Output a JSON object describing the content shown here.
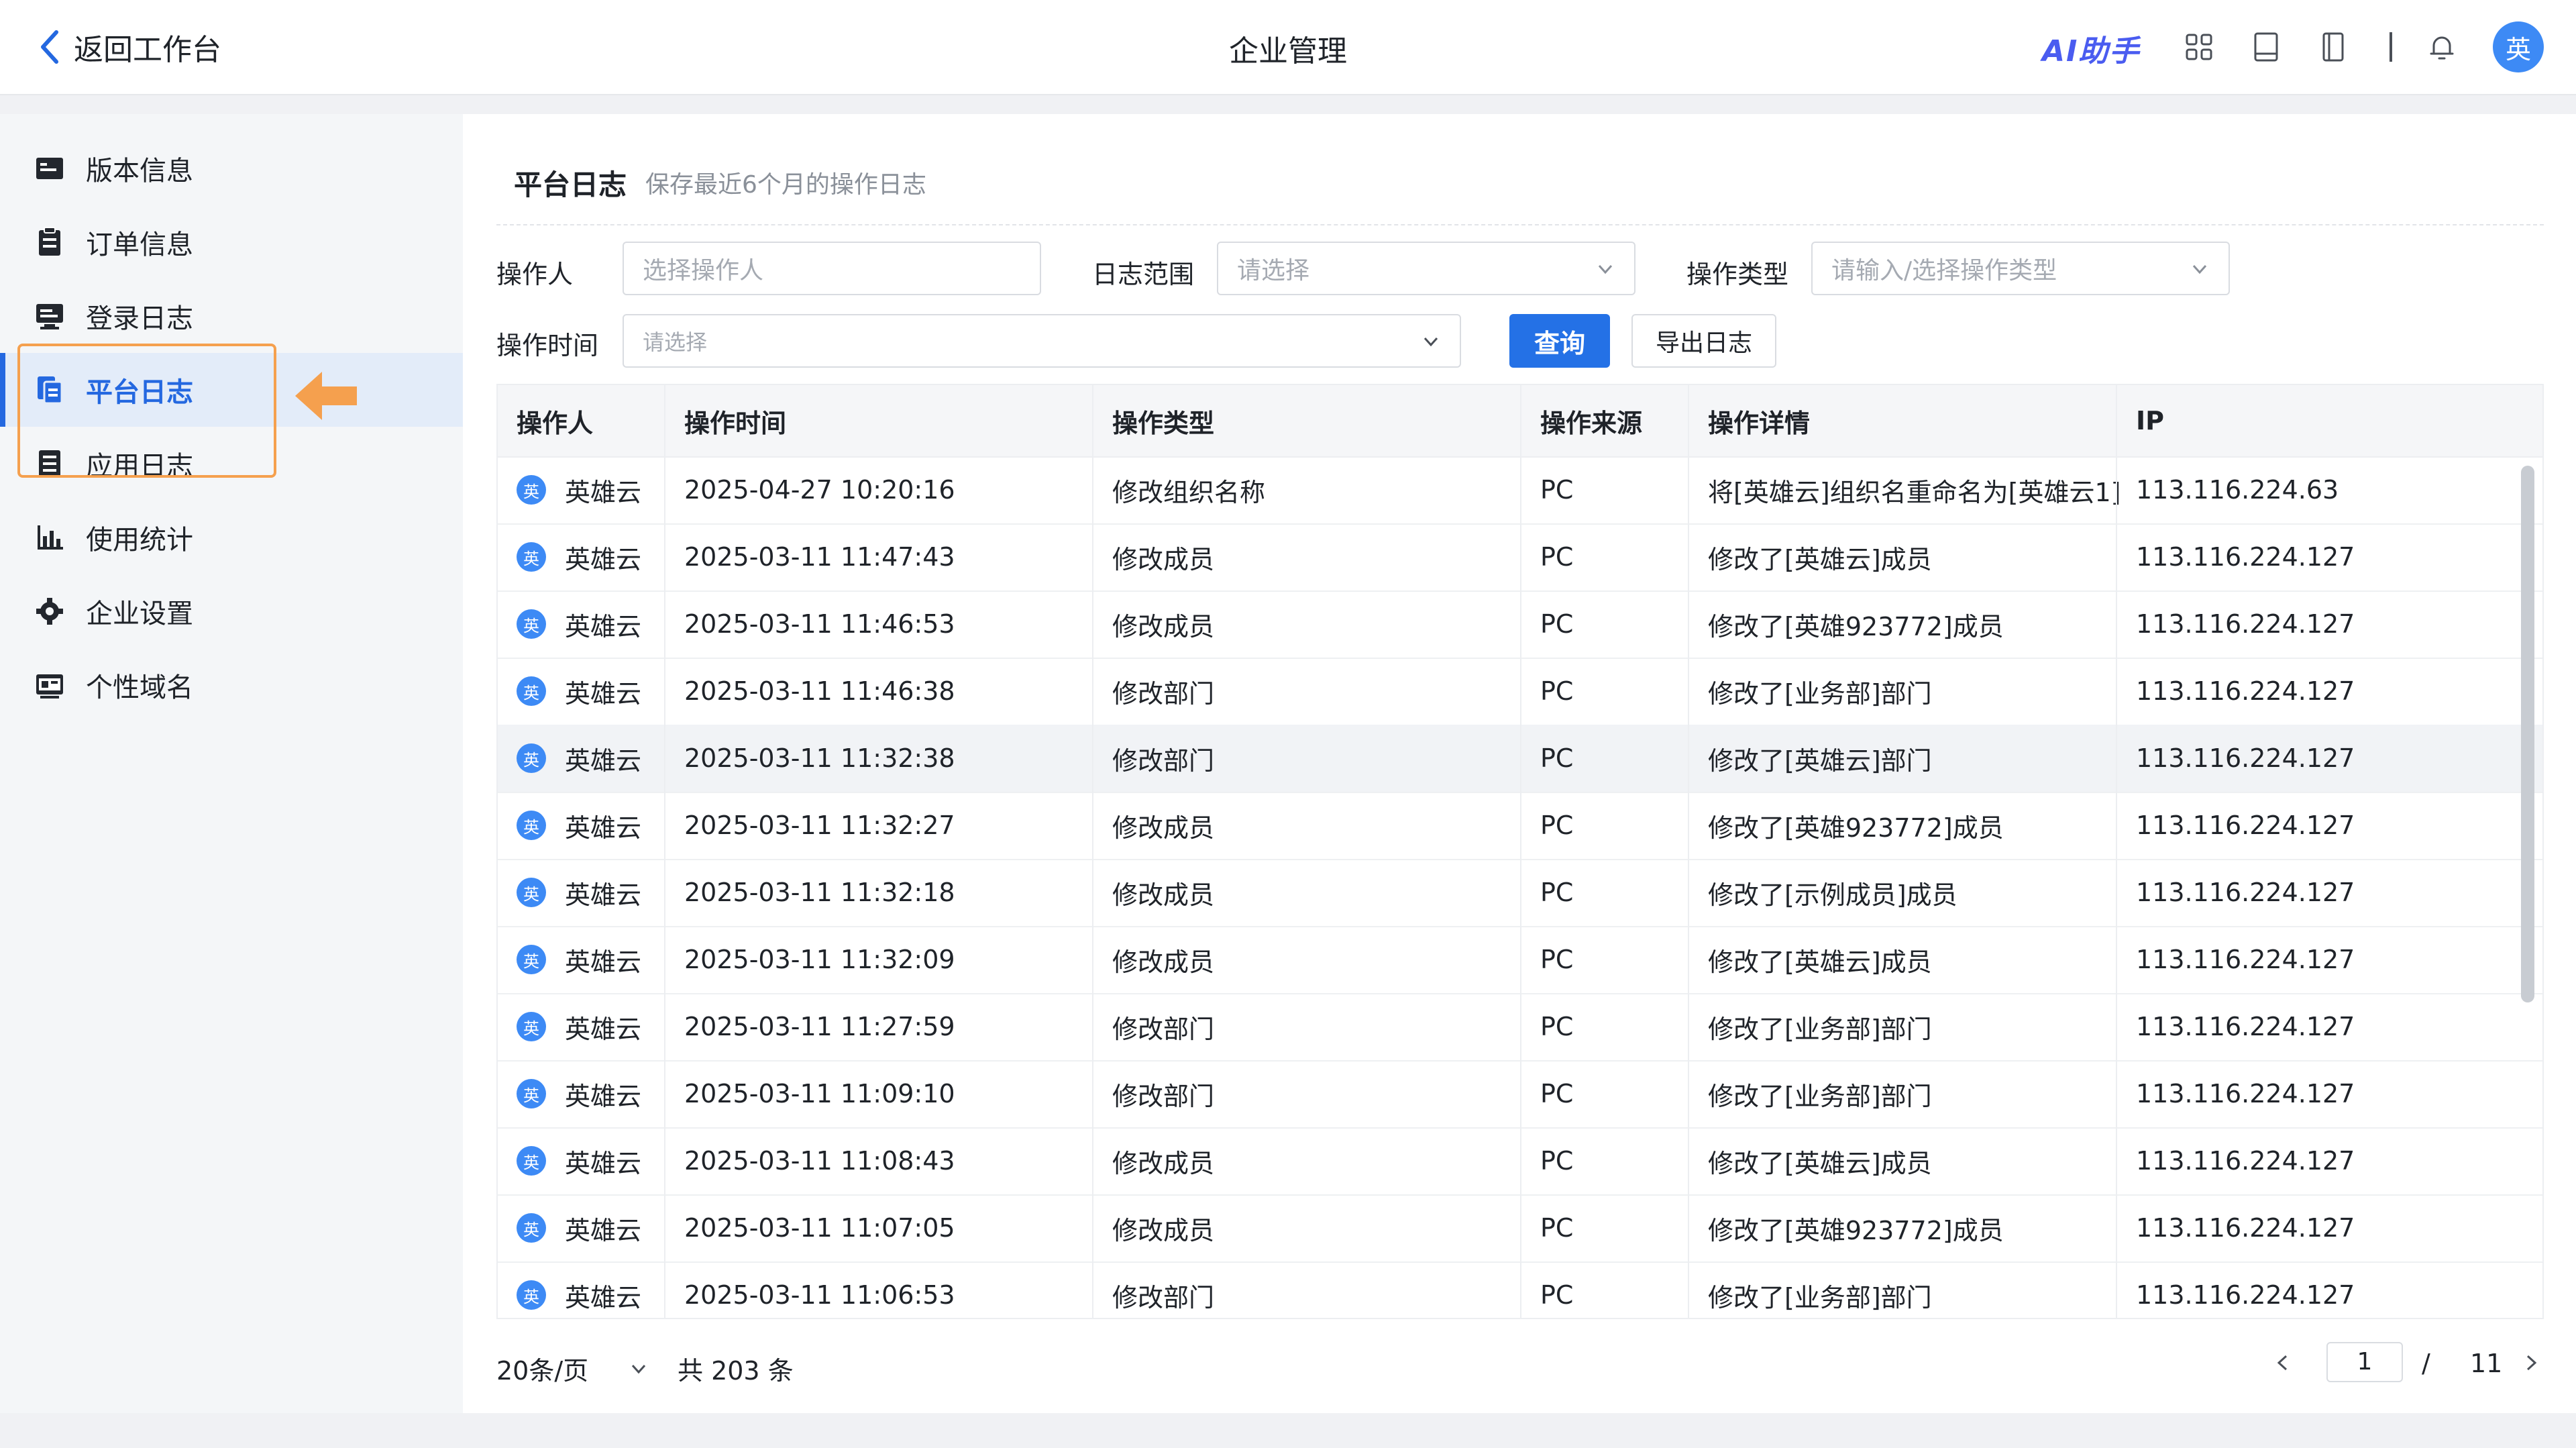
{
  "header": {
    "back_label": "返回工作台",
    "title": "企业管理",
    "ai_label": "AI助手",
    "avatar_text": "英",
    "icons": [
      "apps-grid-icon",
      "book-icon",
      "notebook-icon",
      "bell-icon"
    ]
  },
  "sidebar": {
    "items": [
      {
        "label": "版本信息",
        "icon": "version-icon"
      },
      {
        "label": "订单信息",
        "icon": "order-icon"
      },
      {
        "label": "登录日志",
        "icon": "login-log-icon"
      },
      {
        "label": "平台日志",
        "icon": "platform-log-icon",
        "active": true
      },
      {
        "label": "应用日志",
        "icon": "app-log-icon"
      },
      {
        "label": "使用统计",
        "icon": "stats-icon"
      },
      {
        "label": "企业设置",
        "icon": "gear-icon"
      },
      {
        "label": "个性域名",
        "icon": "domain-icon"
      }
    ]
  },
  "main": {
    "title": "平台日志",
    "subtitle": "保存最近6个月的操作日志",
    "filters": {
      "operator_label": "操作人",
      "operator_placeholder": "选择操作人",
      "range_label": "日志范围",
      "range_placeholder": "请选择",
      "type_label": "操作类型",
      "type_placeholder": "请输入/选择操作类型",
      "time_label": "操作时间",
      "time_placeholder": "请选择"
    },
    "query_button": "查询",
    "export_button": "导出日志",
    "table": {
      "columns": [
        "操作人",
        "操作时间",
        "操作类型",
        "操作来源",
        "操作详情",
        "IP"
      ],
      "avatar_text": "英",
      "rows": [
        [
          "英雄云",
          "2025-04-27 10:20:16",
          "修改组织名称",
          "PC",
          "将[英雄云]组织名重命名为[英雄云1]",
          "113.116.224.63"
        ],
        [
          "英雄云",
          "2025-03-11 11:47:43",
          "修改成员",
          "PC",
          "修改了[英雄云]成员",
          "113.116.224.127"
        ],
        [
          "英雄云",
          "2025-03-11 11:46:53",
          "修改成员",
          "PC",
          "修改了[英雄923772]成员",
          "113.116.224.127"
        ],
        [
          "英雄云",
          "2025-03-11 11:46:38",
          "修改部门",
          "PC",
          "修改了[业务部]部门",
          "113.116.224.127"
        ],
        [
          "英雄云",
          "2025-03-11 11:32:38",
          "修改部门",
          "PC",
          "修改了[英雄云]部门",
          "113.116.224.127"
        ],
        [
          "英雄云",
          "2025-03-11 11:32:27",
          "修改成员",
          "PC",
          "修改了[英雄923772]成员",
          "113.116.224.127"
        ],
        [
          "英雄云",
          "2025-03-11 11:32:18",
          "修改成员",
          "PC",
          "修改了[示例成员]成员",
          "113.116.224.127"
        ],
        [
          "英雄云",
          "2025-03-11 11:32:09",
          "修改成员",
          "PC",
          "修改了[英雄云]成员",
          "113.116.224.127"
        ],
        [
          "英雄云",
          "2025-03-11 11:27:59",
          "修改部门",
          "PC",
          "修改了[业务部]部门",
          "113.116.224.127"
        ],
        [
          "英雄云",
          "2025-03-11 11:09:10",
          "修改部门",
          "PC",
          "修改了[业务部]部门",
          "113.116.224.127"
        ],
        [
          "英雄云",
          "2025-03-11 11:08:43",
          "修改成员",
          "PC",
          "修改了[英雄云]成员",
          "113.116.224.127"
        ],
        [
          "英雄云",
          "2025-03-11 11:07:05",
          "修改成员",
          "PC",
          "修改了[英雄923772]成员",
          "113.116.224.127"
        ],
        [
          "英雄云",
          "2025-03-11 11:06:53",
          "修改部门",
          "PC",
          "修改了[业务部]部门",
          "113.116.224.127"
        ]
      ]
    },
    "pagination": {
      "page_size": "20条/页",
      "total": "共 203 条",
      "current_page": "1",
      "separator": "/",
      "total_pages": "11"
    }
  },
  "colors": {
    "accent": "#2471e6",
    "highlight": "#f5a04e",
    "avatar": "#3d8af5"
  }
}
